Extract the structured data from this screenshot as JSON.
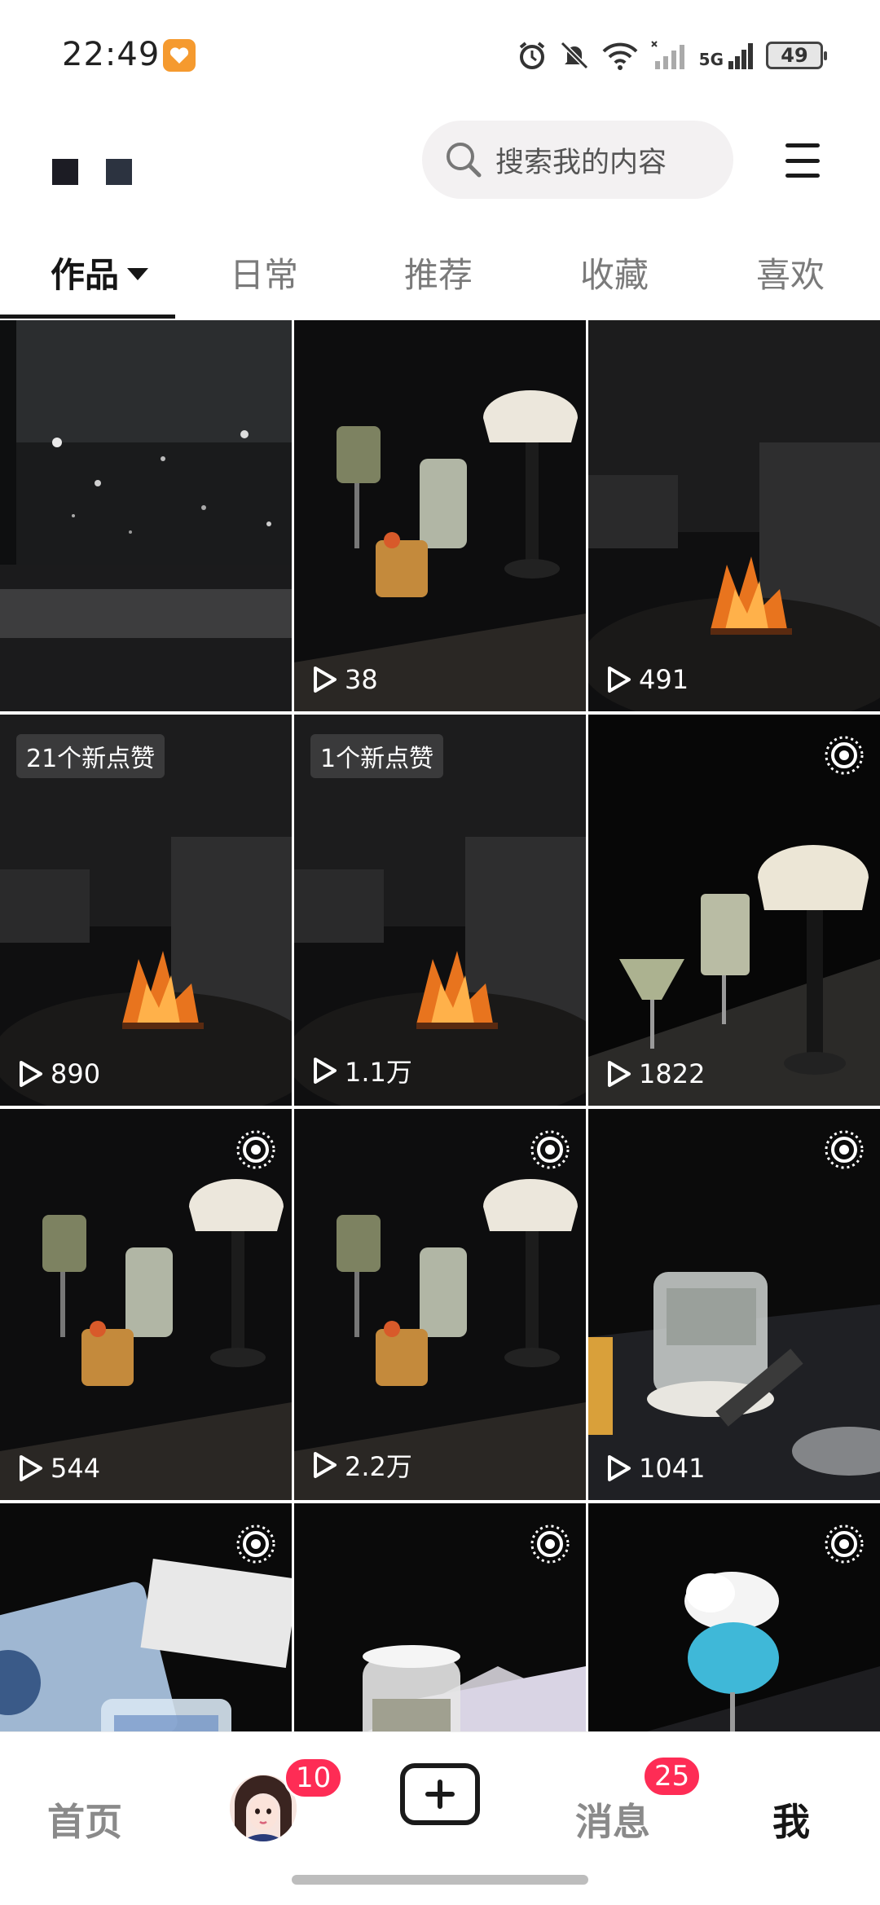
{
  "status_bar": {
    "time": "22:49",
    "battery_level": "49",
    "network": "5G",
    "icons": [
      "heart-app-icon",
      "alarm-icon",
      "mute-icon",
      "wifi-icon",
      "signal-icon",
      "battery-icon"
    ]
  },
  "header": {
    "search_placeholder": "搜索我的内容",
    "menu_icon": "hamburger-menu-icon"
  },
  "tabs": [
    {
      "label": "作品",
      "active": true
    },
    {
      "label": "日常",
      "active": false
    },
    {
      "label": "推荐",
      "active": false
    },
    {
      "label": "收藏",
      "active": false
    },
    {
      "label": "喜欢",
      "active": false
    }
  ],
  "videos": [
    {
      "scene": "rain-window",
      "plays": "",
      "badge": "",
      "live": false
    },
    {
      "scene": "drinks-lamp",
      "plays": "38",
      "badge": "",
      "live": false
    },
    {
      "scene": "fire-lounge",
      "plays": "491",
      "badge": "",
      "live": false
    },
    {
      "scene": "fire-lounge",
      "plays": "890",
      "badge": "21个新点赞",
      "live": false
    },
    {
      "scene": "fire-lounge",
      "plays": "1.1万",
      "badge": "1个新点赞",
      "live": false
    },
    {
      "scene": "cocktail-lamp",
      "plays": "1822",
      "badge": "",
      "live": true
    },
    {
      "scene": "drinks-lamp",
      "plays": "544",
      "badge": "",
      "live": true
    },
    {
      "scene": "drinks-lamp",
      "plays": "2.2万",
      "badge": "",
      "live": true
    },
    {
      "scene": "ice-glass",
      "plays": "1041",
      "badge": "",
      "live": true
    },
    {
      "scene": "tablet-drink",
      "plays": "",
      "badge": "",
      "live": true
    },
    {
      "scene": "whisky-tablet",
      "plays": "",
      "badge": "",
      "live": true
    },
    {
      "scene": "blue-cocktail",
      "plays": "",
      "badge": "",
      "live": true
    }
  ],
  "bottom_nav": {
    "home": "首页",
    "friends_badge": "10",
    "create_icon": "plus-icon",
    "messages": "消息",
    "messages_badge": "25",
    "me": "我"
  },
  "colors": {
    "accent_red": "#fe2c55",
    "text_primary": "#161616",
    "text_secondary": "#7a7a7a",
    "search_bg": "#f3f1f2"
  }
}
